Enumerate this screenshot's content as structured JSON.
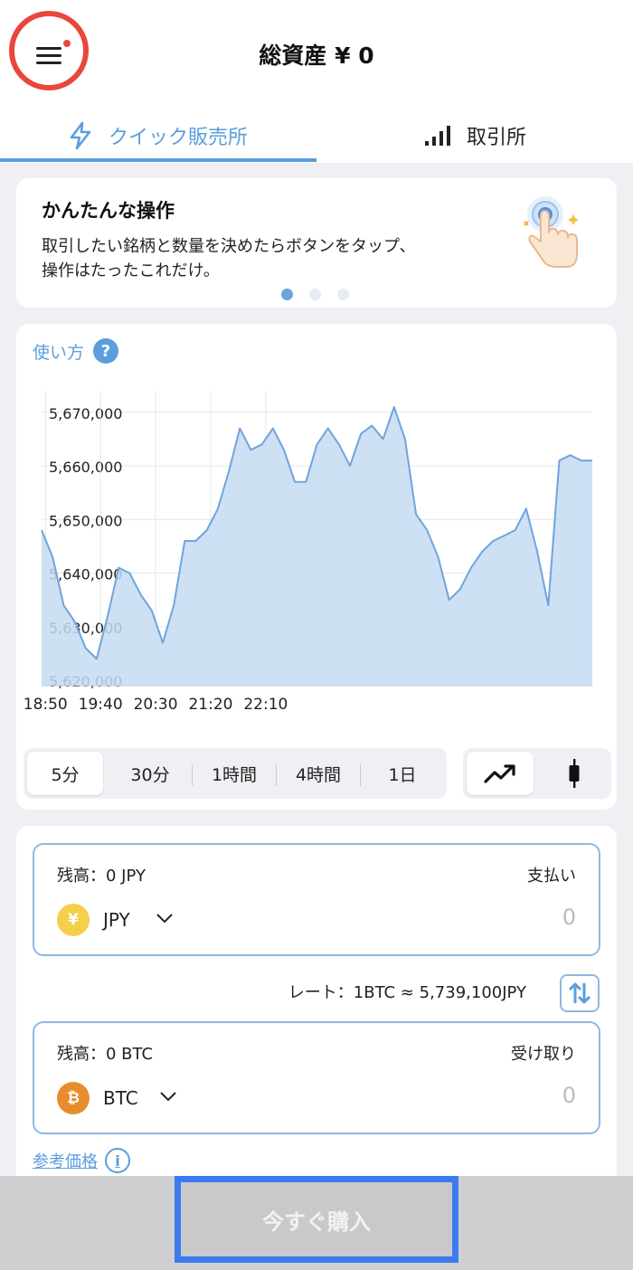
{
  "header": {
    "total_assets": "総資産 ¥ 0",
    "menu_icon": "hamburger-menu-icon",
    "notification_dot_color": "#e8473d",
    "highlight_ring_color": "#e8473d"
  },
  "tabs": [
    {
      "label": "クイック販売所",
      "icon": "lightning-icon",
      "active": true
    },
    {
      "label": "取引所",
      "icon": "signal-bars-icon",
      "active": false
    }
  ],
  "intro": {
    "title": "かんたんな操作",
    "line1": "取引したい銘柄と数量を決めたらボタンをタップ、",
    "line2": "操作はたったこれだけ。",
    "illustration": "tap-hand-icon",
    "page_count": 3,
    "active_page": 0
  },
  "chart": {
    "howto_label": "使い方",
    "help_icon": "question-mark-icon",
    "ranges": [
      "5分",
      "30分",
      "1時間",
      "4時間",
      "1日"
    ],
    "active_range": "5分",
    "chart_types": [
      "line-chart-icon",
      "candlestick-icon"
    ],
    "active_type": "line-chart-icon"
  },
  "chart_data": {
    "type": "area",
    "title": "",
    "xlabel": "",
    "ylabel": "",
    "x_tick_labels": [
      "18:50",
      "19:40",
      "20:30",
      "21:20",
      "22:10"
    ],
    "y_tick_labels": [
      "5,670,000",
      "5,660,000",
      "5,650,000",
      "5,640,000",
      "5,630,000",
      "5,620,000"
    ],
    "ylim": [
      5619000,
      5673000
    ],
    "y_ticks": [
      5670000,
      5660000,
      5650000,
      5640000,
      5630000,
      5620000
    ],
    "x_tick_index": [
      0.35,
      5.35,
      10.35,
      15.35,
      20.35
    ],
    "grid": true,
    "line_color": "#6fa4dd",
    "fill_color": "#c4daf2",
    "values": [
      5648000,
      5643000,
      5634000,
      5631000,
      5626000,
      5624000,
      5632000,
      5641000,
      5640000,
      5636000,
      5633000,
      5627000,
      5634000,
      5646000,
      5646000,
      5648000,
      5652000,
      5659000,
      5667000,
      5663000,
      5664000,
      5667000,
      5663000,
      5657000,
      5657000,
      5664000,
      5667000,
      5664000,
      5660000,
      5666000,
      5667500,
      5665000,
      5671000,
      5665000,
      5651000,
      5648000,
      5643000,
      5635000,
      5637000,
      5641000,
      5644000,
      5646000,
      5647000,
      5648000,
      5652000,
      5644000,
      5634000,
      5661000,
      5662000,
      5661000,
      5661000
    ]
  },
  "trade": {
    "pay": {
      "balance": "残高：0 JPY",
      "label": "支払い",
      "currency": "JPY",
      "coin_symbol": "¥",
      "amount": "0"
    },
    "receive": {
      "balance": "残高：0 BTC",
      "label": "受け取り",
      "currency": "BTC",
      "coin_symbol": "₿",
      "amount": "0"
    },
    "rate": "レート：1BTC ≈ 5,739,100JPY",
    "swap_icon": "swap-arrows-icon",
    "reference_price": "参考価格",
    "info_icon": "info-icon"
  },
  "buy_button": {
    "label": "今すぐ購入",
    "highlight_color": "#3c7bef"
  }
}
